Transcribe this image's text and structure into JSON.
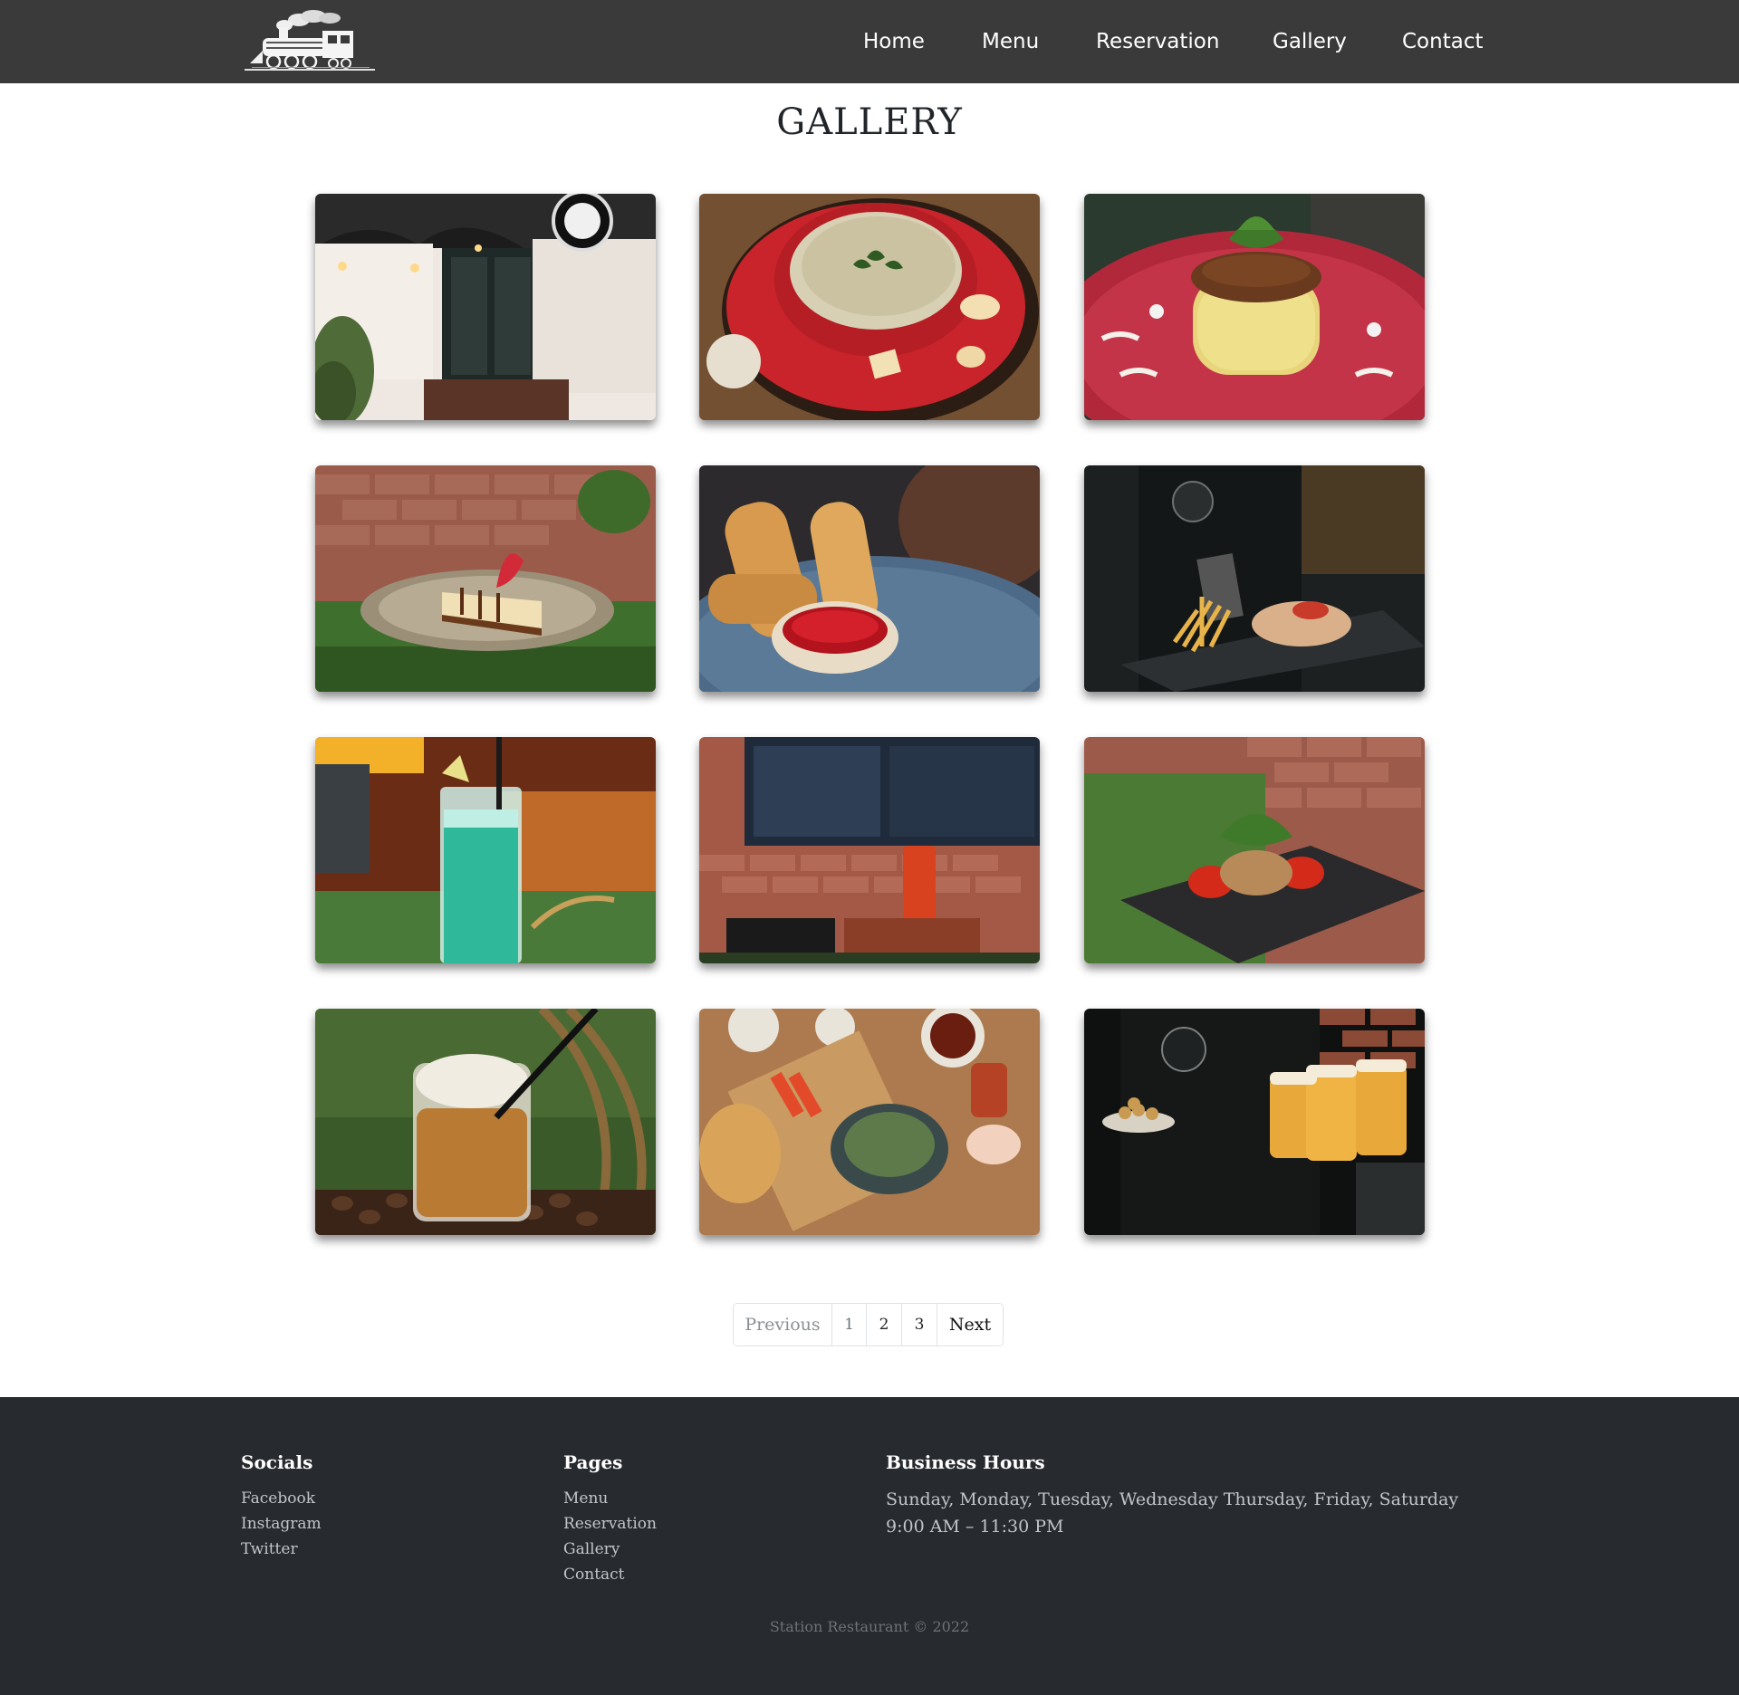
{
  "colors": {
    "navbar_bg": "#3a3a3a",
    "footer_bg": "#272a2e",
    "nav_text": "#ffffff",
    "footer_muted": "#c2c6ca"
  },
  "nav": {
    "logo_icon": "steam-train-logo-icon",
    "items": [
      {
        "label": "Home"
      },
      {
        "label": "Menu"
      },
      {
        "label": "Reservation"
      },
      {
        "label": "Gallery"
      },
      {
        "label": "Contact"
      }
    ]
  },
  "page": {
    "title": "GALLERY"
  },
  "gallery": {
    "images": [
      {
        "name": "restaurant-entrance-photo"
      },
      {
        "name": "soup-bowl-photo"
      },
      {
        "name": "rice-dish-photo"
      },
      {
        "name": "cheesecake-photo"
      },
      {
        "name": "fried-sticks-photo"
      },
      {
        "name": "waiter-fries-photo"
      },
      {
        "name": "green-drink-photo"
      },
      {
        "name": "red-drink-train-photo"
      },
      {
        "name": "grilled-plate-photo"
      },
      {
        "name": "iced-coffee-photo"
      },
      {
        "name": "breakfast-table-photo"
      },
      {
        "name": "beer-waiter-photo"
      }
    ]
  },
  "pagination": {
    "previous": "Previous",
    "pages": [
      "1",
      "2",
      "3"
    ],
    "next": "Next"
  },
  "footer": {
    "socials": {
      "heading": "Socials",
      "links": [
        "Facebook",
        "Instagram",
        "Twitter"
      ]
    },
    "pages": {
      "heading": "Pages",
      "links": [
        "Menu",
        "Reservation",
        "Gallery",
        "Contact"
      ]
    },
    "hours": {
      "heading": "Business Hours",
      "days": "Sunday, Monday, Tuesday, Wednesday Thursday, Friday, Saturday",
      "time": "9:00 AM – 11:30 PM"
    },
    "copyright": "Station Restaurant © 2022"
  }
}
